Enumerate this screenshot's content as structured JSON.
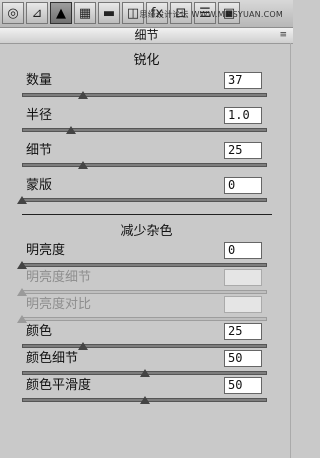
{
  "toolbar": {
    "tools": [
      {
        "icon": "aperture-icon",
        "glyph": "◎",
        "active": false
      },
      {
        "icon": "tone-curve-icon",
        "glyph": "⊿",
        "active": false
      },
      {
        "icon": "triangle-detail-icon",
        "glyph": "▲",
        "active": true
      },
      {
        "icon": "hsl-icon",
        "glyph": "▦",
        "active": false
      },
      {
        "icon": "split-toning-icon",
        "glyph": "▬",
        "active": false
      },
      {
        "icon": "lens-icon",
        "glyph": "◫",
        "active": false
      },
      {
        "icon": "fx-icon",
        "glyph": "fx",
        "active": false
      },
      {
        "icon": "camera-calibration-icon",
        "glyph": "⊡",
        "active": false
      },
      {
        "icon": "presets-icon",
        "glyph": "☰",
        "active": false
      },
      {
        "icon": "snapshots-icon",
        "glyph": "▣",
        "active": false
      }
    ],
    "watermark": "思缘设计论坛 WWW.MISSYUAN.COM"
  },
  "panel": {
    "title": "细节",
    "menu_icon": "panel-menu-icon"
  },
  "sharpening": {
    "title": "锐化",
    "rows": [
      {
        "label": "数量",
        "value": "37",
        "level": 0.25,
        "enabled": true
      },
      {
        "label": "半径",
        "value": "1.0",
        "level": 0.2,
        "enabled": true
      },
      {
        "label": "细节",
        "value": "25",
        "level": 0.25,
        "enabled": true
      },
      {
        "label": "蒙版",
        "value": "0",
        "level": 0.0,
        "enabled": true
      }
    ]
  },
  "noise": {
    "title": "减少杂色",
    "rows": [
      {
        "label": "明亮度",
        "value": "0",
        "level": 0.0,
        "enabled": true
      },
      {
        "label": "明亮度细节",
        "value": "",
        "level": 0.0,
        "enabled": false
      },
      {
        "label": "明亮度对比",
        "value": "",
        "level": 0.0,
        "enabled": false
      },
      {
        "label": "颜色",
        "value": "25",
        "level": 0.25,
        "enabled": true
      },
      {
        "label": "颜色细节",
        "value": "50",
        "level": 0.5,
        "enabled": true
      },
      {
        "label": "颜色平滑度",
        "value": "50",
        "level": 0.5,
        "enabled": true
      }
    ]
  }
}
